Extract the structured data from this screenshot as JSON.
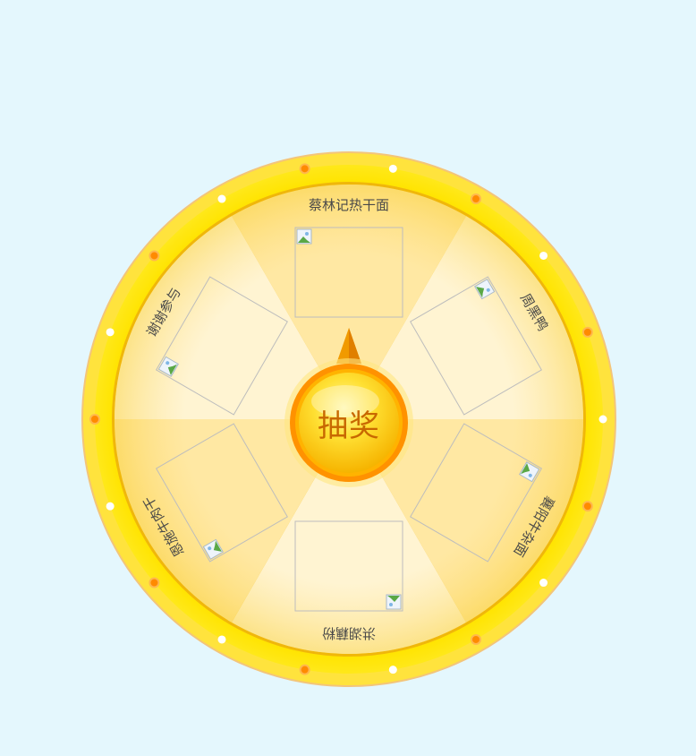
{
  "wheel": {
    "button_label": "抽奖",
    "colors": {
      "rim_outer": "#ffe500",
      "rim_inner": "#f4c20d",
      "sector_light": "#fff4d2",
      "sector_dark": "#ffe8a3",
      "bulb_orange": "#ff8a00",
      "bulb_white": "#ffffff",
      "button_ring": "#ff9a00",
      "button_face": "#ffdc2e",
      "label_text": "#4a4a4a"
    },
    "prizes": [
      {
        "label": "蔡林记热干面",
        "image_icon": "broken-image-icon"
      },
      {
        "label": "周黑鸭",
        "image_icon": "broken-image-icon"
      },
      {
        "label": "襄阳牛杂面",
        "image_icon": "broken-image-icon"
      },
      {
        "label": "洪湖藕粉",
        "image_icon": "broken-image-icon"
      },
      {
        "label": "恩施牛肉干",
        "image_icon": "broken-image-icon"
      },
      {
        "label": "谢谢参与",
        "image_icon": "broken-image-icon"
      }
    ]
  }
}
